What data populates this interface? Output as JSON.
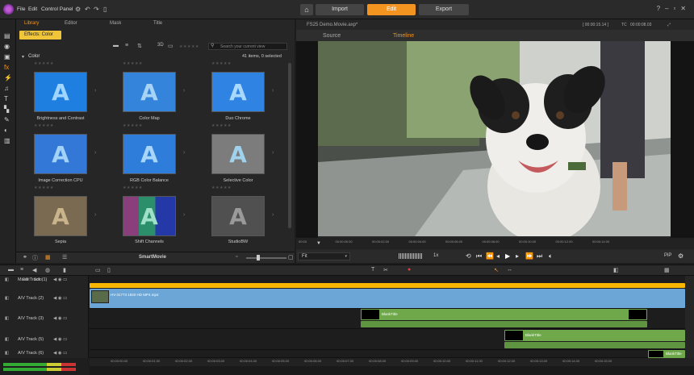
{
  "menu": {
    "file": "File",
    "edit": "Edit",
    "control_panel": "Control Panel"
  },
  "modes": {
    "import": "Import",
    "edit": "Edit",
    "export": "Export"
  },
  "left_tabs": {
    "library": "Library",
    "editor": "Editor",
    "mask": "Mask",
    "title": "Title"
  },
  "chip": "Effects: Color",
  "search_placeholder": "Search your current view",
  "breadcrumb": "Color",
  "items_count": "41 items, 0 selected",
  "stars": "★★★★★",
  "brand_label": "SmartMovie",
  "effects": [
    {
      "name": "Brightness and Contrast",
      "bg": "#1f7fe0",
      "fg": "#9fd5ff"
    },
    {
      "name": "Color Map",
      "bg": "#3584dc",
      "fg": "#a6d3f6"
    },
    {
      "name": "Duo Chrome",
      "bg": "#2f83e3",
      "fg": "#a9d8ff"
    },
    {
      "name": "Image Correction CPU",
      "bg": "#3378d6",
      "fg": "#a2d2f6"
    },
    {
      "name": "RGB Color Balance",
      "bg": "#2f7ddb",
      "fg": "#a7d6f8"
    },
    {
      "name": "Selective Color",
      "bg": "#7c7c7c",
      "fg": "#a0d2ee"
    },
    {
      "name": "Sepia",
      "bg": "#7a6a52",
      "fg": "#c9b48c"
    },
    {
      "name": "Shift Channels",
      "bg": "#3b4ea8",
      "fg": "#9fe0c8"
    },
    {
      "name": "StudioBW",
      "bg": "#505050",
      "fg": "#9a9a9a"
    }
  ],
  "player": {
    "title": "FS25 Demo.Movie.axp*",
    "timecode_left": "[ 00:00:15.14 ]",
    "tc_label": "TC",
    "timecode_right": "00:00:08.03",
    "tabs": {
      "source": "Source",
      "timeline": "Timeline"
    },
    "fit": "Fit",
    "speed": "1x",
    "pip": "PiP"
  },
  "ruler_ticks": [
    "00:00",
    "00:00:00.00",
    "00:00:02.00",
    "00:00:04.00",
    "00:00:06.00",
    "00:00:08.00",
    "00:00:10.00",
    "00:00:12.00",
    "00:00:14.00"
  ],
  "track_header": {
    "edit": "Edit",
    "solo": "Solo"
  },
  "tracks": [
    {
      "name": "Mask Track (1)"
    },
    {
      "name": "A/V Track (2)"
    },
    {
      "name": "A/V Track (3)"
    },
    {
      "name": "A/V Track (5)"
    },
    {
      "name": "A/V Track (6)"
    }
  ],
  "clips": {
    "video": "HV-31773 1920 HD MP4.mp4",
    "title1": "BlankTitle",
    "title2": "BlankTitle",
    "title3": "BlankTitle"
  },
  "timeline_ticks": [
    "00:00:00.00",
    "00:00:01.00",
    "00:00:02.00",
    "00:00:03.00",
    "00:00:04.00",
    "00:00:05.00",
    "00:00:06.00",
    "00:00:07.00",
    "00:00:08.00",
    "00:00:09.00",
    "00:00:10.00",
    "00:00:11.00",
    "00:00:12.00",
    "00:00:13.00",
    "00:00:14.00",
    "00:00:15.00"
  ],
  "colors": {
    "accent": "#f39421",
    "mask_bar": "#f7b600",
    "video_clip": "#6ba6d6",
    "title_clip": "#6ea84b"
  }
}
